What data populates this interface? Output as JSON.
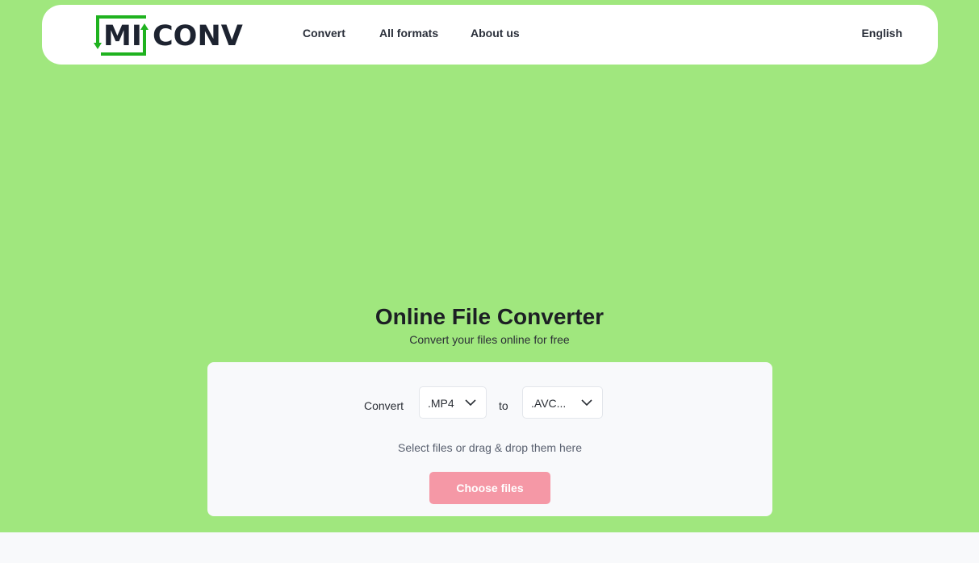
{
  "brand": {
    "name_prefix": "MI",
    "name_suffix": "CONV",
    "accent_color": "#1fb21f"
  },
  "nav": {
    "items": [
      {
        "label": "Convert"
      },
      {
        "label": "All formats"
      },
      {
        "label": "About us"
      }
    ],
    "language": "English"
  },
  "hero": {
    "title": "Online File Converter",
    "subtitle": "Convert your files online for free",
    "background_color": "#a0e77e"
  },
  "converter": {
    "convert_label": "Convert",
    "from_value": ".MP4",
    "to_label": "to",
    "to_value": ".AVC...",
    "hint": "Select files or drag & drop them here",
    "choose_button": "Choose files",
    "button_color": "#f598a6"
  },
  "icons": {
    "logo": "miconv-logo-icon",
    "from_dropdown": "chevron-down-icon",
    "to_dropdown": "chevron-down-icon"
  }
}
